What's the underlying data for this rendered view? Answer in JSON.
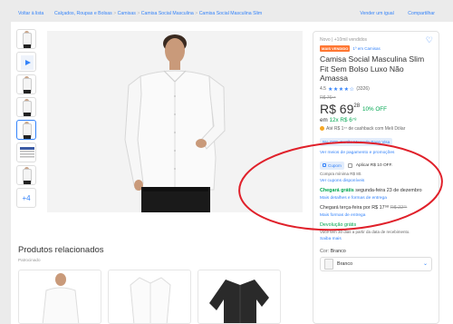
{
  "nav": {
    "back": "Voltar à lista",
    "breadcrumbs": [
      "Calçados, Roupas e Bolsas",
      "Camisas",
      "Camisa Social Masculina",
      "Camisa Social Masculina Slim"
    ],
    "sell_similar": "Vender um igual",
    "share": "Compartilhar"
  },
  "product": {
    "status": "Novo  |  +10mil vendidos",
    "badge_best_seller": "MAIS VENDIDO",
    "badge_ranking": "1º em Camisas",
    "title": "Camisa Social Masculina Slim Fit Sem Bolso Luxo Não Amassa",
    "rating_value": "4.5",
    "rating_stars": "★★★★☆",
    "rating_count": "(3326)",
    "old_price": "R$ 76⁹⁸",
    "price_main": "R$ 69",
    "price_cents": "28",
    "discount": "10% OFF",
    "installments_prefix": "em ",
    "installments": "12x R$ 6⁷⁸",
    "cashback": "Até R$ 1⁷⁷ de cashback com Meli Dólar",
    "promo_card": "5% OFF. Cartão Mercado Pago Visa",
    "payment_link": "Ver meios de pagamento e promoções",
    "coupon_label": "Cupom",
    "coupon_apply": "Aplicar R$ 10 OFF.",
    "coupon_min": "Compra mínima R$ 80.",
    "coupons_link": "Ver cupons disponíveis",
    "ship_free_label": "Chegará grátis",
    "ship_free_date": " segunda-feira 23 de dezembro",
    "ship_free_link": "Mais detalhes e formas de entrega",
    "ship_paid": "Chegará terça-feira por R$ 17⁹⁸ ",
    "ship_paid_old": "R$ 22⁷⁵",
    "ship_paid_link": "Mais formas de entrega",
    "returns_label": "Devolução grátis",
    "returns_text": "Você tem 30 dias a partir da data de recebimento.",
    "returns_link": "Saiba mais",
    "color_label": "Cor: ",
    "color_value": "Branco",
    "color_selected": "Branco"
  },
  "related": {
    "title": "Produtos relacionados",
    "subtitle": "Patrocinado"
  },
  "colors": {
    "accent": "#3483fa",
    "green": "#00a650",
    "orange": "#ff7733",
    "annotation": "#e0202a"
  }
}
